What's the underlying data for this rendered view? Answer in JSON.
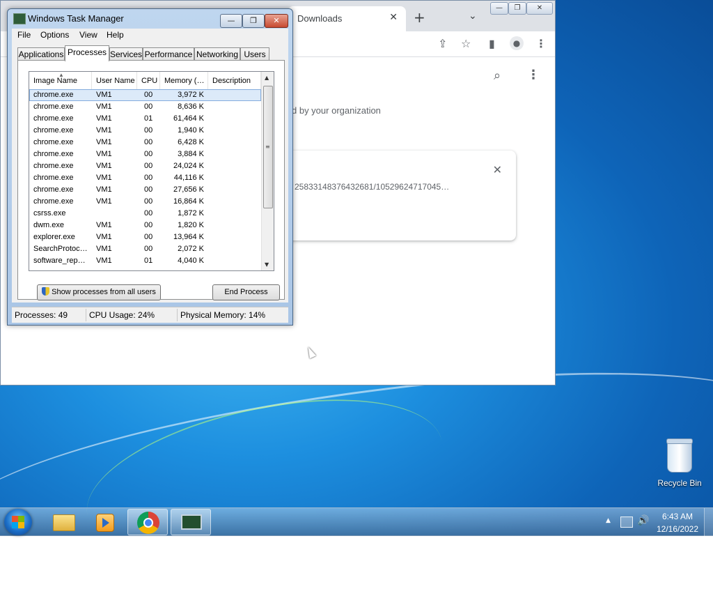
{
  "chrome": {
    "tab_title": "Downloads",
    "tab_close": "✕",
    "new_tab": "+",
    "tab_search": "⌄",
    "managed_text": "d by your organization",
    "download_url": "25833148376432681/10529624717045…",
    "window_controls": {
      "minimize": "—",
      "restore": "❐",
      "close": "✕"
    }
  },
  "taskmanager": {
    "title": "Windows Task Manager",
    "controls": {
      "minimize": "—",
      "restore": "❐",
      "close": "✕"
    },
    "menu": [
      "File",
      "Options",
      "View",
      "Help"
    ],
    "tabs": [
      "Applications",
      "Processes",
      "Services",
      "Performance",
      "Networking",
      "Users"
    ],
    "active_tab": "Processes",
    "columns": [
      "Image Name",
      "User Name",
      "CPU",
      "Memory (…",
      "Description"
    ],
    "rows": [
      [
        "chrome.exe",
        "VM1",
        "00",
        "3,972 K",
        ""
      ],
      [
        "chrome.exe",
        "VM1",
        "00",
        "8,636 K",
        ""
      ],
      [
        "chrome.exe",
        "VM1",
        "01",
        "61,464 K",
        ""
      ],
      [
        "chrome.exe",
        "VM1",
        "00",
        "1,940 K",
        ""
      ],
      [
        "chrome.exe",
        "VM1",
        "00",
        "6,428 K",
        ""
      ],
      [
        "chrome.exe",
        "VM1",
        "00",
        "3,884 K",
        ""
      ],
      [
        "chrome.exe",
        "VM1",
        "00",
        "24,024 K",
        ""
      ],
      [
        "chrome.exe",
        "VM1",
        "00",
        "44,116 K",
        ""
      ],
      [
        "chrome.exe",
        "VM1",
        "00",
        "27,656 K",
        ""
      ],
      [
        "chrome.exe",
        "VM1",
        "00",
        "16,864 K",
        ""
      ],
      [
        "csrss.exe",
        "",
        "00",
        "1,872 K",
        ""
      ],
      [
        "dwm.exe",
        "VM1",
        "00",
        "1,820 K",
        ""
      ],
      [
        "explorer.exe",
        "VM1",
        "00",
        "13,964 K",
        ""
      ],
      [
        "SearchProtoc…",
        "VM1",
        "00",
        "2,072 K",
        ""
      ],
      [
        "software_rep…",
        "VM1",
        "01",
        "4,040 K",
        ""
      ]
    ],
    "selected_row": 0,
    "show_all_button": "Show processes from all users",
    "end_process_button": "End Process",
    "status": {
      "processes": "Processes: 49",
      "cpu": "CPU Usage: 24%",
      "memory": "Physical Memory: 14%"
    }
  },
  "desktop": {
    "recycle_bin_label": "Recycle Bin"
  },
  "taskbar": {
    "clock_time": "6:43 AM",
    "clock_date": "12/16/2022",
    "items": [
      "start-icon",
      "folder-icon",
      "media-player-icon",
      "chrome-icon",
      "task-manager-icon"
    ]
  }
}
